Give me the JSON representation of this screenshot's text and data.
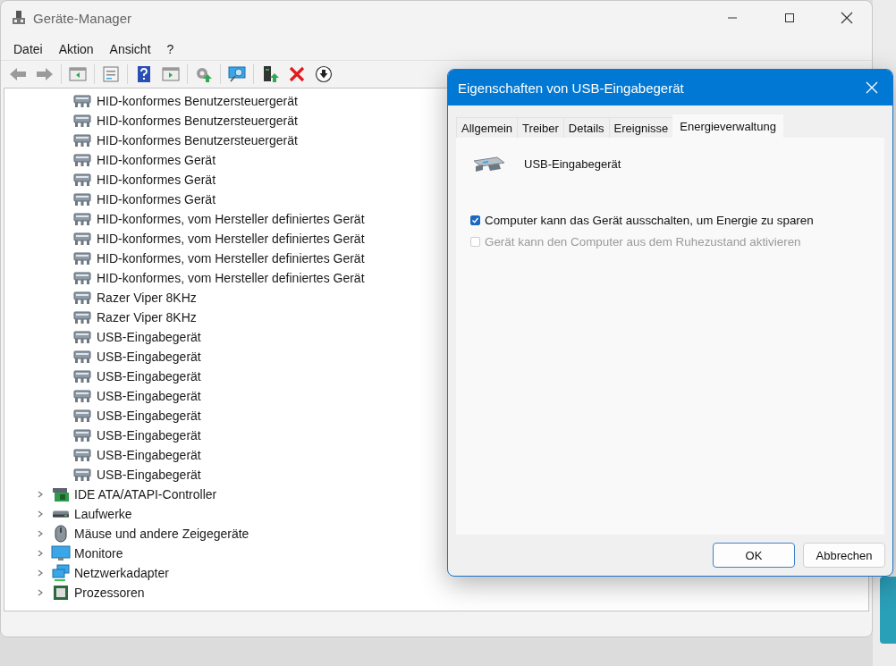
{
  "window": {
    "title": "Geräte-Manager"
  },
  "menu": [
    "Datei",
    "Aktion",
    "Ansicht",
    "?"
  ],
  "tree": {
    "items": [
      {
        "children": [
          {
            "label": "HID-konformes Benutzersteuergerät"
          },
          {
            "label": "HID-konformes Benutzersteuergerät"
          },
          {
            "label": "HID-konformes Benutzersteuergerät"
          },
          {
            "label": "HID-konformes Gerät"
          },
          {
            "label": "HID-konformes Gerät"
          },
          {
            "label": "HID-konformes Gerät"
          },
          {
            "label": "HID-konformes, vom Hersteller definiertes Gerät"
          },
          {
            "label": "HID-konformes, vom Hersteller definiertes Gerät"
          },
          {
            "label": "HID-konformes, vom Hersteller definiertes Gerät"
          },
          {
            "label": "HID-konformes, vom Hersteller definiertes Gerät"
          },
          {
            "label": "Razer Viper 8KHz"
          },
          {
            "label": "Razer Viper 8KHz"
          },
          {
            "label": "USB-Eingabegerät"
          },
          {
            "label": "USB-Eingabegerät"
          },
          {
            "label": "USB-Eingabegerät"
          },
          {
            "label": "USB-Eingabegerät"
          },
          {
            "label": "USB-Eingabegerät"
          },
          {
            "label": "USB-Eingabegerät"
          },
          {
            "label": "USB-Eingabegerät"
          },
          {
            "label": "USB-Eingabegerät"
          }
        ]
      },
      {
        "label": "IDE ATA/ATAPI-Controller",
        "kind": "controller",
        "expanded": false
      },
      {
        "label": "Laufwerke",
        "kind": "drive",
        "expanded": false
      },
      {
        "label": "Mäuse und andere Zeigegeräte",
        "kind": "mouse",
        "expanded": false
      },
      {
        "label": "Monitore",
        "kind": "monitor",
        "expanded": false
      },
      {
        "label": "Netzwerkadapter",
        "kind": "network",
        "expanded": false
      },
      {
        "label": "Prozessoren",
        "kind": "cpu",
        "expanded": false
      }
    ]
  },
  "dialog": {
    "title": "Eigenschaften von USB-Eingabegerät",
    "tabs": [
      {
        "label": "Allgemein",
        "selected": false
      },
      {
        "label": "Treiber",
        "selected": false
      },
      {
        "label": "Details",
        "selected": false
      },
      {
        "label": "Ereignisse",
        "selected": false
      },
      {
        "label": "Energieverwaltung",
        "selected": true
      }
    ],
    "device_name": "USB-Eingabegerät",
    "options": [
      {
        "label": "Computer kann das Gerät ausschalten, um Energie zu sparen",
        "checked": true,
        "disabled": false
      },
      {
        "label": "Gerät kann den Computer aus dem Ruhezustand aktivieren",
        "checked": false,
        "disabled": true
      }
    ],
    "buttons": [
      {
        "label": "OK",
        "default": true
      },
      {
        "label": "Abbrechen",
        "default": false
      }
    ]
  }
}
